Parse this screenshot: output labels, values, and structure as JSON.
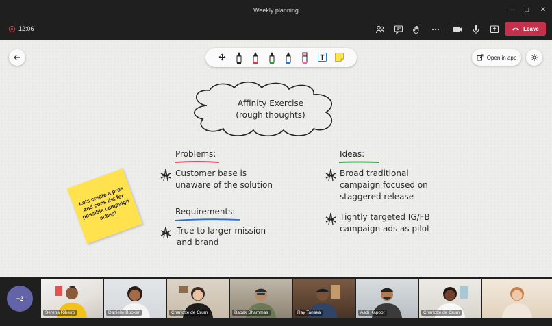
{
  "window": {
    "title": "Weekly planning"
  },
  "toolbar": {
    "timer": "12:06",
    "leave_label": "Leave"
  },
  "whiteboard": {
    "open_in_app_label": "Open in app",
    "cloud_line1": "Affinity Exercise",
    "cloud_line2": "(rough thoughts)",
    "problems_heading": "Problems:",
    "problem_1_line1": "Customer base is",
    "problem_1_line2": "unaware of the solution",
    "requirements_heading": "Requirements:",
    "requirement_1_line1": "True to larger mission",
    "requirement_1_line2": "and brand",
    "ideas_heading": "Ideas:",
    "idea_1_line1": "Broad traditional",
    "idea_1_line2": "campaign focused on",
    "idea_1_line3": "staggered release",
    "idea_2_line1": "Tightly targeted IG/FB",
    "idea_2_line2": "campaign ads as pilot",
    "sticky_note": "Lets create a pros and cons list for possible campaign aches!"
  },
  "colors": {
    "problems_underline": "#c8364a",
    "requirements_underline": "#2f6fd0",
    "ideas_underline": "#2a8a3c",
    "sticky": "#ffe24d",
    "leave": "#c4314b",
    "more_badge": "#6264a7"
  },
  "participants": {
    "more_count": "+2",
    "tiles": [
      {
        "name": "Serena Ribeiro"
      },
      {
        "name": "Danielle Booker"
      },
      {
        "name": "Charlotte de Crum"
      },
      {
        "name": "Babak Shammas"
      },
      {
        "name": "Ray Tanaka"
      },
      {
        "name": "Aadi Kapoor"
      },
      {
        "name": "Charlotte de Crum"
      },
      {
        "name": ""
      }
    ]
  }
}
